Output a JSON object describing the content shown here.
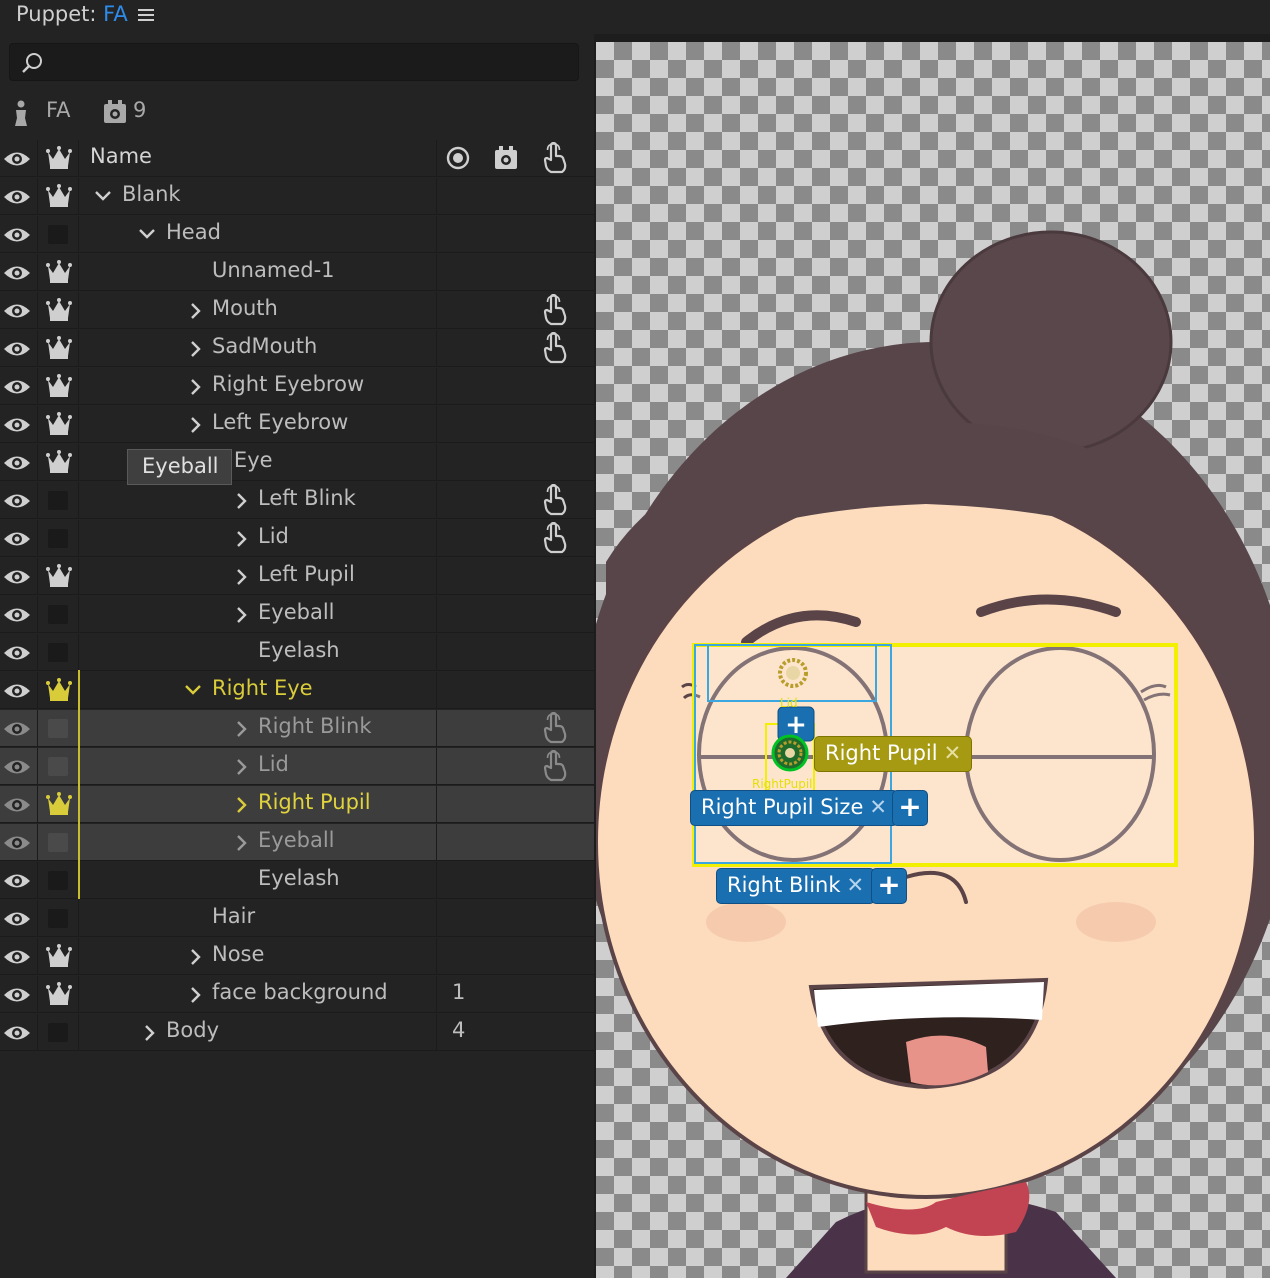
{
  "titlebar": {
    "prefix": "Puppet: ",
    "puppet": "FA"
  },
  "search": {
    "value": "",
    "placeholder": ""
  },
  "puppet_info": {
    "name": "FA",
    "behaviors_count": "9"
  },
  "header": {
    "name_label": "Name"
  },
  "tooltip": "Eyeball",
  "rows": [
    {
      "label": "Blank",
      "count": ""
    },
    {
      "label": "Head",
      "count": ""
    },
    {
      "label": "Unnamed-1",
      "count": ""
    },
    {
      "label": "Mouth",
      "count": ""
    },
    {
      "label": "SadMouth",
      "count": ""
    },
    {
      "label": "Right Eyebrow",
      "count": ""
    },
    {
      "label": "Left Eyebrow",
      "count": ""
    },
    {
      "label": "ft Eye",
      "count": ""
    },
    {
      "label": "Left Blink",
      "count": ""
    },
    {
      "label": "Lid",
      "count": ""
    },
    {
      "label": "Left Pupil",
      "count": ""
    },
    {
      "label": "Eyeball",
      "count": ""
    },
    {
      "label": "Eyelash",
      "count": ""
    },
    {
      "label": "Right Eye",
      "count": ""
    },
    {
      "label": "Right Blink",
      "count": ""
    },
    {
      "label": "Lid",
      "count": ""
    },
    {
      "label": "Right Pupil",
      "count": ""
    },
    {
      "label": "Eyeball",
      "count": ""
    },
    {
      "label": "Eyelash",
      "count": ""
    },
    {
      "label": "Hair",
      "count": ""
    },
    {
      "label": "Nose",
      "count": ""
    },
    {
      "label": "face background",
      "count": "1"
    },
    {
      "label": "Body",
      "count": "4"
    }
  ],
  "canvas": {
    "tag_right_pupil": "Right Pupil",
    "tag_right_pupil_size": "Right Pupil Size",
    "tag_right_blink": "Right Blink",
    "handle_lid_label": "Lid",
    "handle_pupil_label": "RightPupil",
    "close_glyph": "✕",
    "plus_glyph": "+"
  },
  "colors": {
    "accent": "#2d8ceb",
    "selected_yellow": "#d9cc3a",
    "tag_blue": "#1a6fb0",
    "tag_olive": "#a69a12",
    "skin": "#fcdcbd",
    "hair": "#57454a"
  }
}
